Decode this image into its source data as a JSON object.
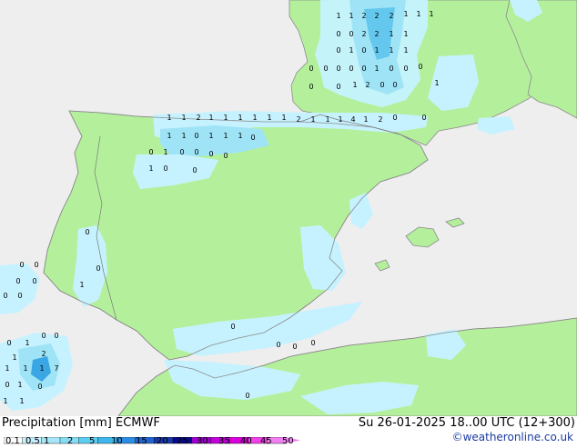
{
  "header": {
    "title_left": "Precipitation [mm] ECMWF",
    "title_right": "Su 26-01-2025 18..00 UTC (12+300)",
    "credit": "©weatheronline.co.uk"
  },
  "legend": {
    "labels": [
      "0.1",
      "0.5",
      "1",
      "2",
      "5",
      "10",
      "15",
      "20",
      "25",
      "30",
      "35",
      "40",
      "45",
      "50"
    ],
    "colors": [
      "#ffffff",
      "#c8f0ff",
      "#a6e6f8",
      "#86dcf4",
      "#5ecdf0",
      "#3fb7ea",
      "#2c8ee0",
      "#2264cc",
      "#1838a8",
      "#0a0a88",
      "#9a00c8",
      "#c000d8",
      "#d800d8",
      "#f040e8",
      "#f080f0"
    ]
  },
  "map": {
    "land_color": "#b4f09c",
    "sea_color": "#eeeeee",
    "coast_color": "#8a8a8a",
    "precip_light": "#c6f2ff",
    "precip_mid": "#9ee4f6",
    "precip_strong": "#64c8ee",
    "precip_peak": "#3aa6e4",
    "marks": [
      "1",
      "1",
      "2",
      "2",
      "2",
      "1",
      "1",
      "1",
      "0",
      "0",
      "2",
      "2",
      "1",
      "1",
      "0",
      "1",
      "0",
      "1",
      "1",
      "1",
      "0",
      "0",
      "0",
      "0",
      "0",
      "1",
      "0",
      "0",
      "0",
      "0",
      "0",
      "1",
      "2",
      "0",
      "0",
      "1",
      "1",
      "1",
      "2",
      "1",
      "1",
      "1",
      "1",
      "1",
      "1",
      "2",
      "1",
      "1",
      "1",
      "4",
      "1",
      "2",
      "0",
      "0",
      "1",
      "1",
      "0",
      "1",
      "1",
      "1",
      "0",
      "0",
      "1",
      "0",
      "0",
      "0",
      "0",
      "1",
      "0",
      "0",
      "0",
      "0",
      "1",
      "0",
      "0",
      "0",
      "0",
      "0",
      "0",
      "0",
      "1",
      "0",
      "0",
      "1",
      "2",
      "1",
      "7",
      "1",
      "0",
      "1",
      "0",
      "1",
      "1",
      "1",
      "0",
      "0",
      "0",
      "0",
      "0",
      "0",
      "0"
    ]
  }
}
